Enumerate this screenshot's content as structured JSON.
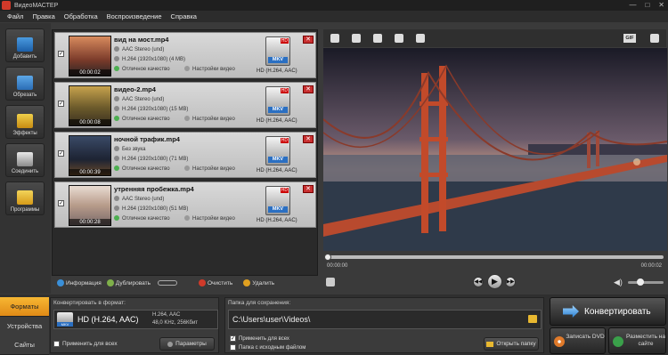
{
  "window": {
    "title": "ВидеоМАСТЕР",
    "controls": [
      "—",
      "□",
      "✕"
    ]
  },
  "menu": [
    "Файл",
    "Правка",
    "Обработка",
    "Воспроизведение",
    "Справка"
  ],
  "left_tools": [
    {
      "label": "Добавить",
      "icon": "add-icon"
    },
    {
      "label": "Обрезать",
      "icon": "cut-icon"
    },
    {
      "label": "Эффекты",
      "icon": "effects-icon"
    },
    {
      "label": "Соединить",
      "icon": "join-icon"
    },
    {
      "label": "Программы",
      "icon": "programs-icon"
    }
  ],
  "files": [
    {
      "name": "вид на мост.mp4",
      "audio": "AAC Stereo (und)",
      "video": "H.264 (1920x1080) (4 MB)",
      "quality": "Отличное качество",
      "settings": "Настройки видео",
      "format_label": "HD (H.264, AAC)",
      "duration": "00:00:02",
      "badge": "MKV"
    },
    {
      "name": "видео-2.mp4",
      "audio": "AAC Stereo (und)",
      "video": "H.264 (1920x1080) (15 MB)",
      "quality": "Отличное качество",
      "settings": "Настройки видео",
      "format_label": "HD (H.264, AAC)",
      "duration": "00:00:08",
      "badge": "MKV"
    },
    {
      "name": "ночной трафик.mp4",
      "audio": "Без звука",
      "video": "H.264 (1920x1080) (71 MB)",
      "quality": "Отличное качество",
      "settings": "Настройки видео",
      "format_label": "HD (H.264, AAC)",
      "duration": "00:00:39",
      "badge": "MKV"
    },
    {
      "name": "утренняя пробежка.mp4",
      "audio": "AAC Stereo (und)",
      "video": "H.264 (1920x1080) (51 MB)",
      "quality": "Отличное качество",
      "settings": "Настройки видео",
      "format_label": "HD (H.264, AAC)",
      "duration": "00:00:28",
      "badge": "MKV"
    }
  ],
  "file_toolbar": {
    "info": "Информация",
    "duplicate": "Дублировать",
    "clear": "Очистить",
    "delete": "Удалить"
  },
  "player": {
    "time_start": "00:00:00",
    "time_end": "00:00:02",
    "gif_label": "GIF",
    "progress": 0
  },
  "tabs": [
    "Форматы",
    "Устройства",
    "Сайты"
  ],
  "convert_format": {
    "heading": "Конвертировать в формат:",
    "name": "HD (H.264, AAC)",
    "spec1": "H.264, AAC",
    "spec2": "48,0 KHz, 256Кбит",
    "apply_all": "Применить для всех",
    "params": "Параметры",
    "badge": "MKV"
  },
  "save_folder": {
    "heading": "Папка для сохранения:",
    "path": "C:\\Users\\user\\Videos\\",
    "apply_all": "Применить для всех",
    "source_folder": "Папка с исходным файлом",
    "open": "Открыть папку"
  },
  "actions": {
    "convert": "Конвертировать",
    "dvd": "Записать DVD",
    "publish": "Разместить на сайте"
  }
}
